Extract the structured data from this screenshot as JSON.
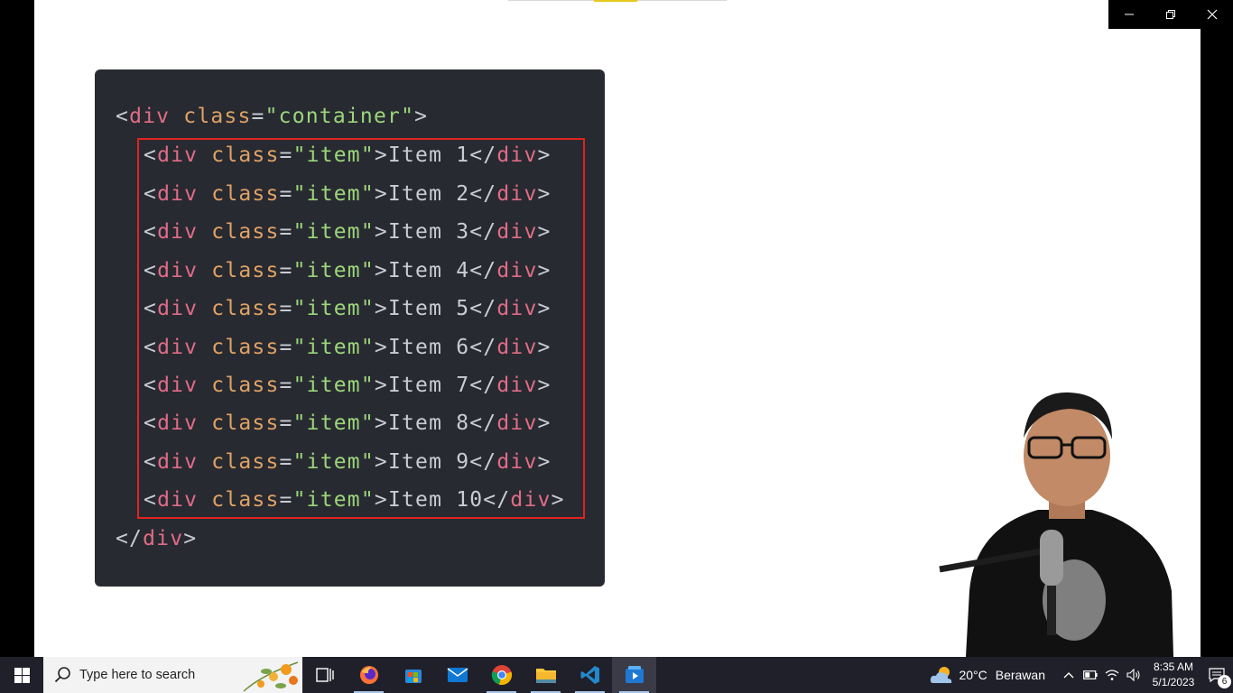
{
  "slide": {
    "code_lines": [
      {
        "parts": [
          [
            "punc",
            "<"
          ],
          [
            "tag",
            "div"
          ],
          [
            "punc",
            " "
          ],
          [
            "attr",
            "class"
          ],
          [
            "punc",
            "="
          ],
          [
            "str",
            "\"container\""
          ],
          [
            "punc",
            ">"
          ]
        ]
      },
      {
        "parts": [
          [
            "punc",
            "<"
          ],
          [
            "tag",
            "div"
          ],
          [
            "punc",
            " "
          ],
          [
            "attr",
            "class"
          ],
          [
            "punc",
            "="
          ],
          [
            "str",
            "\"item\""
          ],
          [
            "punc",
            ">"
          ],
          [
            "text",
            "Item 1"
          ],
          [
            "punc",
            "</"
          ],
          [
            "tag",
            "div"
          ],
          [
            "punc",
            ">"
          ]
        ]
      },
      {
        "parts": [
          [
            "punc",
            "<"
          ],
          [
            "tag",
            "div"
          ],
          [
            "punc",
            " "
          ],
          [
            "attr",
            "class"
          ],
          [
            "punc",
            "="
          ],
          [
            "str",
            "\"item\""
          ],
          [
            "punc",
            ">"
          ],
          [
            "text",
            "Item 2"
          ],
          [
            "punc",
            "</"
          ],
          [
            "tag",
            "div"
          ],
          [
            "punc",
            ">"
          ]
        ]
      },
      {
        "parts": [
          [
            "punc",
            "<"
          ],
          [
            "tag",
            "div"
          ],
          [
            "punc",
            " "
          ],
          [
            "attr",
            "class"
          ],
          [
            "punc",
            "="
          ],
          [
            "str",
            "\"item\""
          ],
          [
            "punc",
            ">"
          ],
          [
            "text",
            "Item 3"
          ],
          [
            "punc",
            "</"
          ],
          [
            "tag",
            "div"
          ],
          [
            "punc",
            ">"
          ]
        ]
      },
      {
        "parts": [
          [
            "punc",
            "<"
          ],
          [
            "tag",
            "div"
          ],
          [
            "punc",
            " "
          ],
          [
            "attr",
            "class"
          ],
          [
            "punc",
            "="
          ],
          [
            "str",
            "\"item\""
          ],
          [
            "punc",
            ">"
          ],
          [
            "text",
            "Item 4"
          ],
          [
            "punc",
            "</"
          ],
          [
            "tag",
            "div"
          ],
          [
            "punc",
            ">"
          ]
        ]
      },
      {
        "parts": [
          [
            "punc",
            "<"
          ],
          [
            "tag",
            "div"
          ],
          [
            "punc",
            " "
          ],
          [
            "attr",
            "class"
          ],
          [
            "punc",
            "="
          ],
          [
            "str",
            "\"item\""
          ],
          [
            "punc",
            ">"
          ],
          [
            "text",
            "Item 5"
          ],
          [
            "punc",
            "</"
          ],
          [
            "tag",
            "div"
          ],
          [
            "punc",
            ">"
          ]
        ]
      },
      {
        "parts": [
          [
            "punc",
            "<"
          ],
          [
            "tag",
            "div"
          ],
          [
            "punc",
            " "
          ],
          [
            "attr",
            "class"
          ],
          [
            "punc",
            "="
          ],
          [
            "str",
            "\"item\""
          ],
          [
            "punc",
            ">"
          ],
          [
            "text",
            "Item 6"
          ],
          [
            "punc",
            "</"
          ],
          [
            "tag",
            "div"
          ],
          [
            "punc",
            ">"
          ]
        ]
      },
      {
        "parts": [
          [
            "punc",
            "<"
          ],
          [
            "tag",
            "div"
          ],
          [
            "punc",
            " "
          ],
          [
            "attr",
            "class"
          ],
          [
            "punc",
            "="
          ],
          [
            "str",
            "\"item\""
          ],
          [
            "punc",
            ">"
          ],
          [
            "text",
            "Item 7"
          ],
          [
            "punc",
            "</"
          ],
          [
            "tag",
            "div"
          ],
          [
            "punc",
            ">"
          ]
        ]
      },
      {
        "parts": [
          [
            "punc",
            "<"
          ],
          [
            "tag",
            "div"
          ],
          [
            "punc",
            " "
          ],
          [
            "attr",
            "class"
          ],
          [
            "punc",
            "="
          ],
          [
            "str",
            "\"item\""
          ],
          [
            "punc",
            ">"
          ],
          [
            "text",
            "Item 8"
          ],
          [
            "punc",
            "</"
          ],
          [
            "tag",
            "div"
          ],
          [
            "punc",
            ">"
          ]
        ]
      },
      {
        "parts": [
          [
            "punc",
            "<"
          ],
          [
            "tag",
            "div"
          ],
          [
            "punc",
            " "
          ],
          [
            "attr",
            "class"
          ],
          [
            "punc",
            "="
          ],
          [
            "str",
            "\"item\""
          ],
          [
            "punc",
            ">"
          ],
          [
            "text",
            "Item 9"
          ],
          [
            "punc",
            "</"
          ],
          [
            "tag",
            "div"
          ],
          [
            "punc",
            ">"
          ]
        ]
      },
      {
        "parts": [
          [
            "punc",
            "<"
          ],
          [
            "tag",
            "div"
          ],
          [
            "punc",
            " "
          ],
          [
            "attr",
            "class"
          ],
          [
            "punc",
            "="
          ],
          [
            "str",
            "\"item\""
          ],
          [
            "punc",
            ">"
          ],
          [
            "text",
            "Item 10"
          ],
          [
            "punc",
            "</"
          ],
          [
            "tag",
            "div"
          ],
          [
            "punc",
            ">"
          ]
        ]
      },
      {
        "parts": [
          [
            "punc",
            "</"
          ],
          [
            "tag",
            "div"
          ],
          [
            "punc",
            ">"
          ]
        ]
      }
    ],
    "highlight_color": "#e0231f",
    "card_background": "#282a31"
  },
  "window_controls": {
    "minimize_icon": "minimize-icon",
    "restore_icon": "restore-icon",
    "close_icon": "close-icon"
  },
  "taskbar": {
    "search_placeholder": "Type here to search",
    "apps": [
      "task-view-icon",
      "firefox-icon",
      "microsoft-store-icon",
      "mail-icon",
      "chrome-icon",
      "file-explorer-icon",
      "vscode-icon",
      "media-player-icon"
    ],
    "weather": {
      "temperature": "20°C",
      "condition": "Berawan"
    },
    "clock": {
      "time": "8:35 AM",
      "date": "5/1/2023"
    },
    "notification_count": "6"
  }
}
